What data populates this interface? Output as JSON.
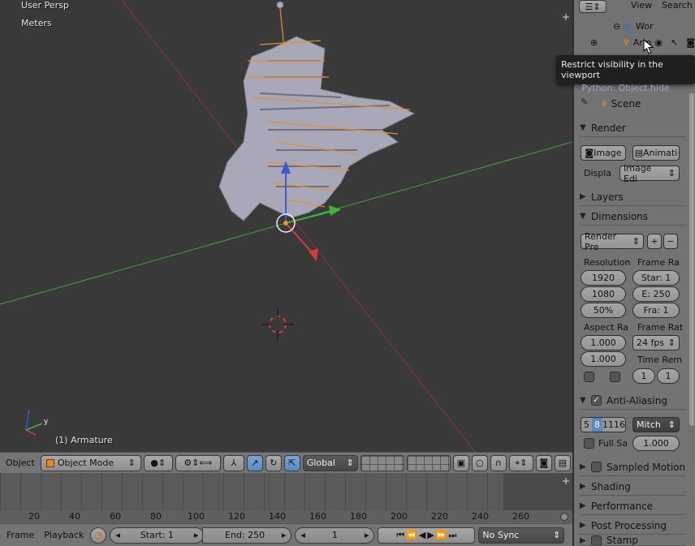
{
  "viewport": {
    "view_label": "User Persp",
    "units_label": "Meters",
    "active_object": "(1) Armature"
  },
  "view3d_header": {
    "object_menu": "Object",
    "mode": "Object Mode",
    "orientation": "Global"
  },
  "timeline": {
    "ticks": [
      "20",
      "40",
      "60",
      "80",
      "100",
      "120",
      "140",
      "160",
      "180",
      "200",
      "220",
      "240",
      "260"
    ],
    "frame_menu": "Frame",
    "playback_menu": "Playback",
    "start": "Start: 1",
    "end": "End: 250",
    "current": "1",
    "sync": "No Sync"
  },
  "outliner": {
    "view_menu": "View",
    "search_menu": "Search",
    "world_label": "Wor",
    "armature_label": "Arm"
  },
  "tooltip": {
    "text": "Restrict visibility in the viewport",
    "python": "Python: Object.hide"
  },
  "properties": {
    "scene_label": "Scene",
    "render": {
      "title": "Render",
      "image_button": "Image",
      "animation_button": "Animati",
      "display_label": "Displa",
      "display_value": "Image Edi"
    },
    "layers_title": "Layers",
    "dimensions": {
      "title": "Dimensions",
      "preset": "Render Pre",
      "resolution_label": "Resolution",
      "res_x": "1920",
      "res_y": "1080",
      "res_pct": "50%",
      "frame_range_label": "Frame Ra",
      "frame_start": "Star: 1",
      "frame_end": "E: 250",
      "frame_step": "Fra: 1",
      "aspect_label": "Aspect Ra",
      "aspect_x": "1.000",
      "aspect_y": "1.000",
      "frame_rate_label": "Frame Rat",
      "frame_rate": "24 fps",
      "time_remap_label": "Time Rem",
      "time_old": "1",
      "time_new": "1"
    },
    "anti_aliasing": {
      "title": "Anti-Aliasing",
      "samples": [
        "5",
        "8",
        "11",
        "16"
      ],
      "filter": "Mitch",
      "full_sample": "Full Sa",
      "size": "1.000"
    },
    "sampled_motion_title": "Sampled Motion",
    "shading_title": "Shading",
    "performance_title": "Performance",
    "post_processing_title": "Post Processing",
    "stamp_title": "Stamp"
  },
  "colors": {
    "x_axis": "#d23c3c",
    "y_axis": "#3cb43c",
    "z_axis": "#3c5ad2",
    "mesh": "#a8a8b8",
    "bone": "#e8902a"
  }
}
